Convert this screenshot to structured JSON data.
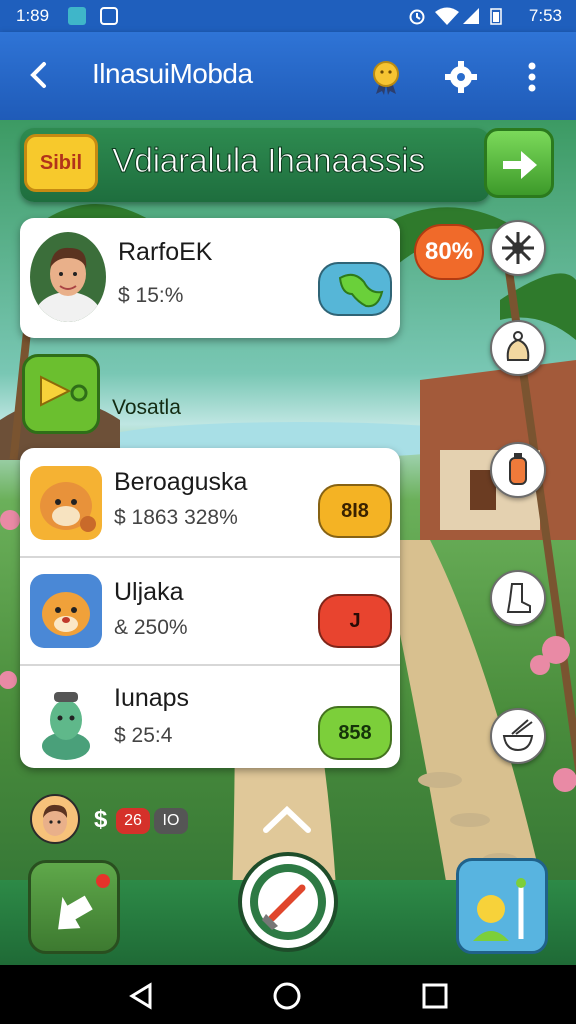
{
  "status": {
    "time_left": "1:89",
    "time_right": "7:53"
  },
  "appbar": {
    "title": "IlnasuiMobda"
  },
  "banner": {
    "badge": "Sibil",
    "title": "Vdiaralula Ihanaassis"
  },
  "progress_badge": "80%",
  "profile": {
    "name": "RarfoEK",
    "stat": "$ 15:%"
  },
  "section_label": "Vosatla",
  "items": [
    {
      "name": "Beroaguska",
      "stat": "$ 1863 328%",
      "action": "8I8",
      "color": "#f4b324"
    },
    {
      "name": "Uljaka",
      "stat": "& 250%",
      "action": "J",
      "color": "#e8442f"
    },
    {
      "name": "Iunaps",
      "stat": "$ 25:4",
      "action": "858",
      "color": "#7ccf3a"
    }
  ],
  "footer": {
    "currency": "$",
    "badge1": "26",
    "badge2": "IO"
  },
  "icons": [
    "back-icon",
    "medal-icon",
    "gear-icon",
    "more-vert-icon",
    "arrow-right-icon",
    "network-icon",
    "bag-icon",
    "bottle-icon",
    "boot-icon",
    "bowl-icon",
    "hammer-icon",
    "chevron-up-icon",
    "home-icon",
    "nav-back-icon",
    "nav-home-icon",
    "nav-recents-icon"
  ]
}
